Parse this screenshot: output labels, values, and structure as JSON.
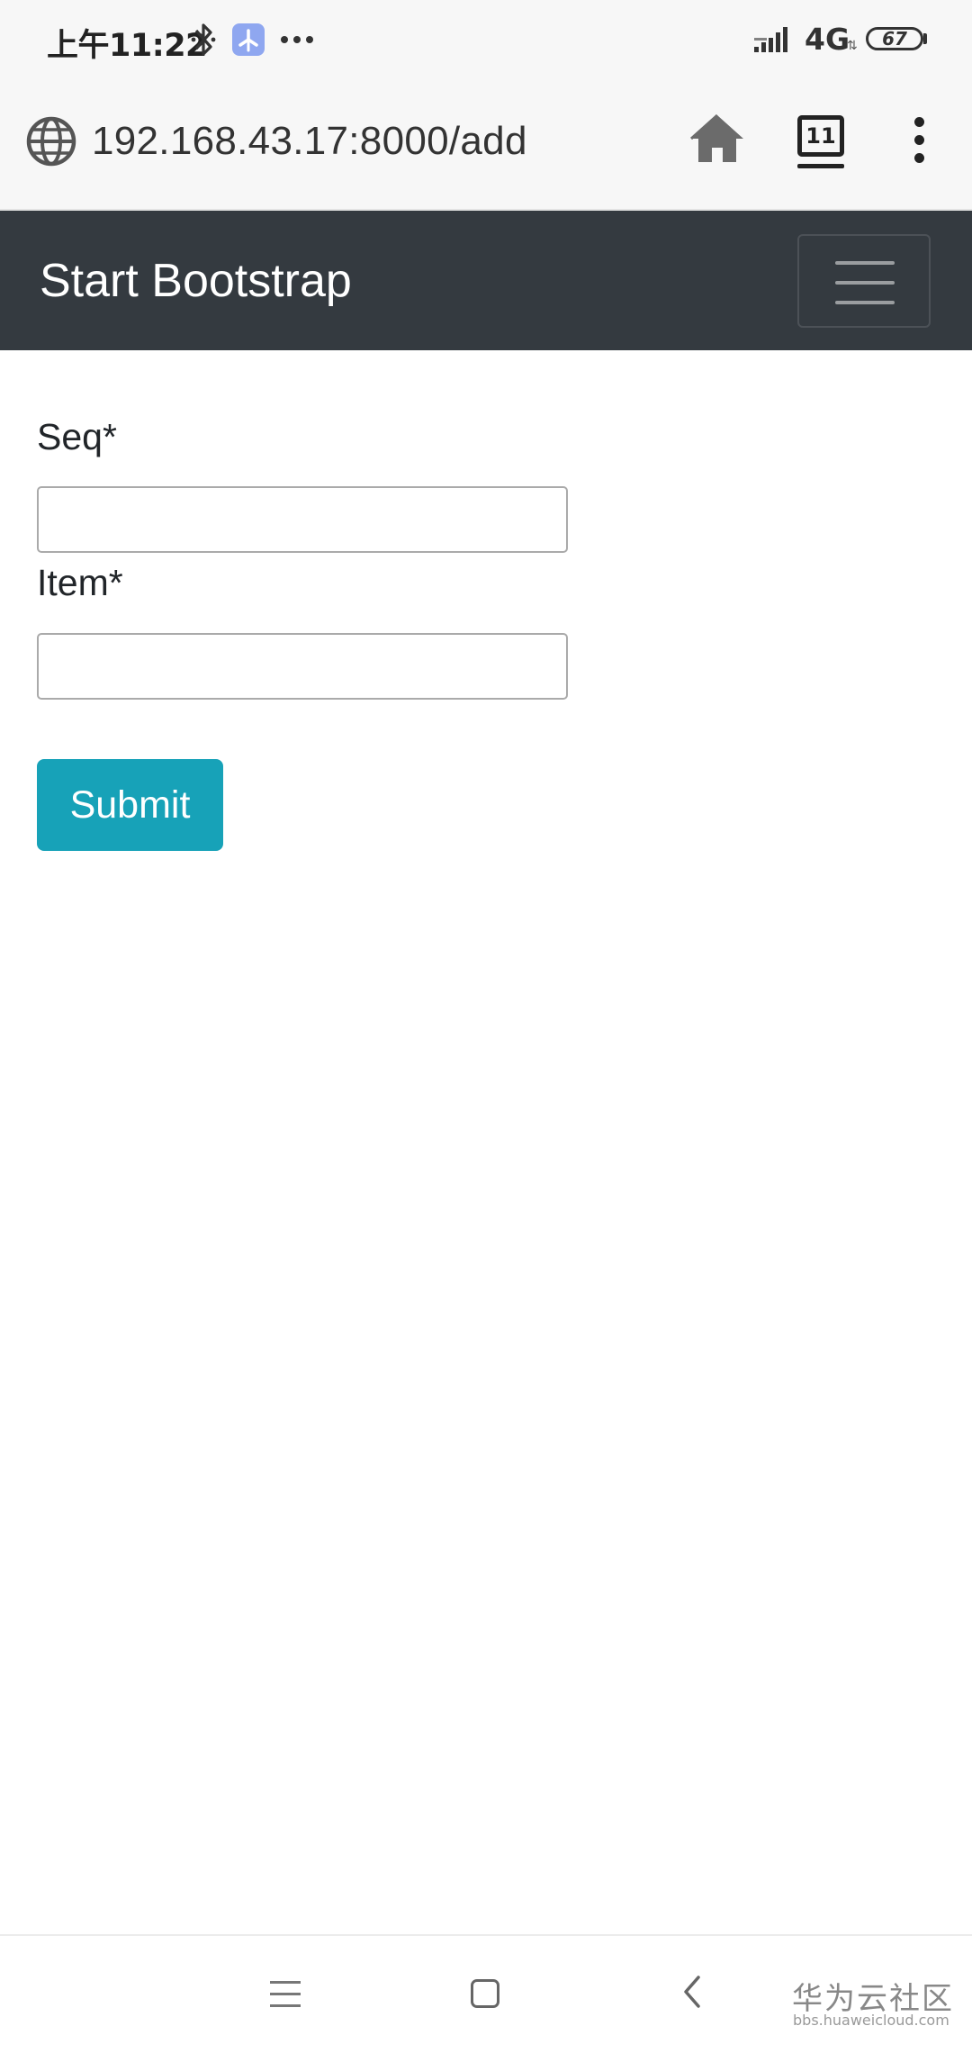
{
  "status_bar": {
    "time": "上午11:22",
    "icons": [
      "bluetooth-icon",
      "fan-app-icon",
      "more-dots-icon",
      "signal-icon",
      "battery-icon"
    ],
    "network": "4G",
    "battery": "67"
  },
  "browser": {
    "url": "192.168.43.17:8000/add",
    "tab_count": "11",
    "icons": [
      "globe-icon",
      "home-icon",
      "tabs-icon",
      "overflow-menu-icon"
    ]
  },
  "navbar": {
    "brand": "Start Bootstrap",
    "bg_color": "#343a40"
  },
  "form": {
    "seq_label": "Seq*",
    "seq_value": "",
    "item_label": "Item*",
    "item_value": "",
    "submit_label": "Submit",
    "submit_color": "#17a2b8"
  },
  "system_nav": {
    "icons": [
      "recents-icon",
      "home-square-icon",
      "back-icon"
    ]
  },
  "watermark": {
    "title": "华为云社区",
    "sub": "bbs.huaweicloud.com"
  }
}
